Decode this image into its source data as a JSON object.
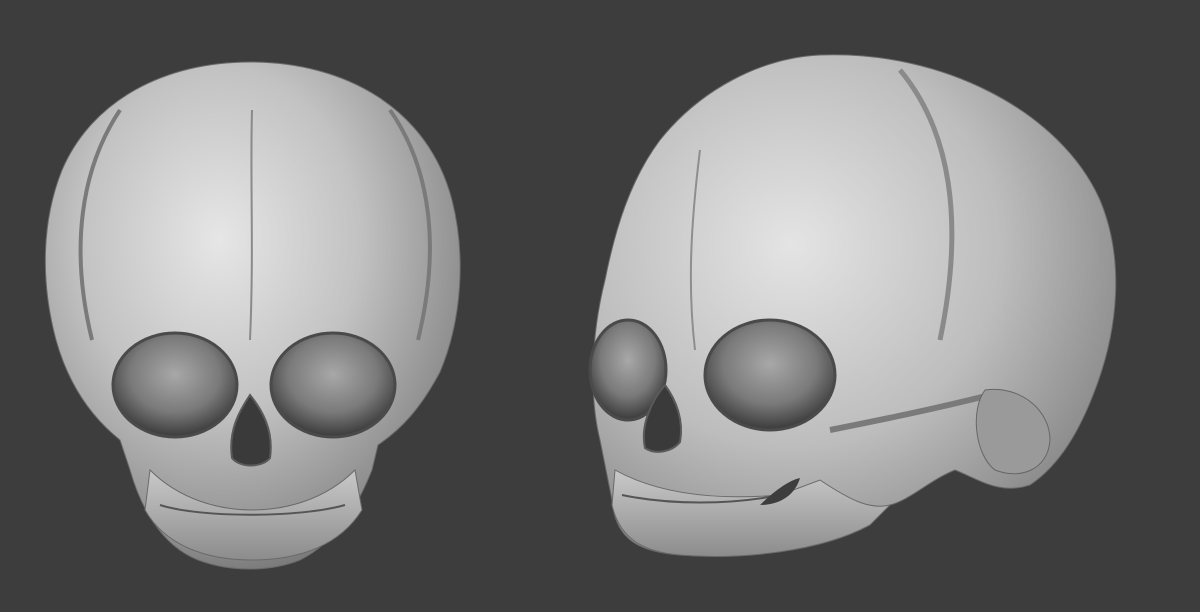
{
  "scene": {
    "background": "#3d3d3d",
    "material": "#b8b8b8",
    "material_highlight": "#e2e2e2",
    "material_shadow": "#5a5a5a",
    "cavity": "#2f2f2f"
  },
  "models": [
    {
      "name": "skull-front-view",
      "view": "front"
    },
    {
      "name": "skull-three-quarter-view",
      "view": "three-quarter"
    }
  ]
}
